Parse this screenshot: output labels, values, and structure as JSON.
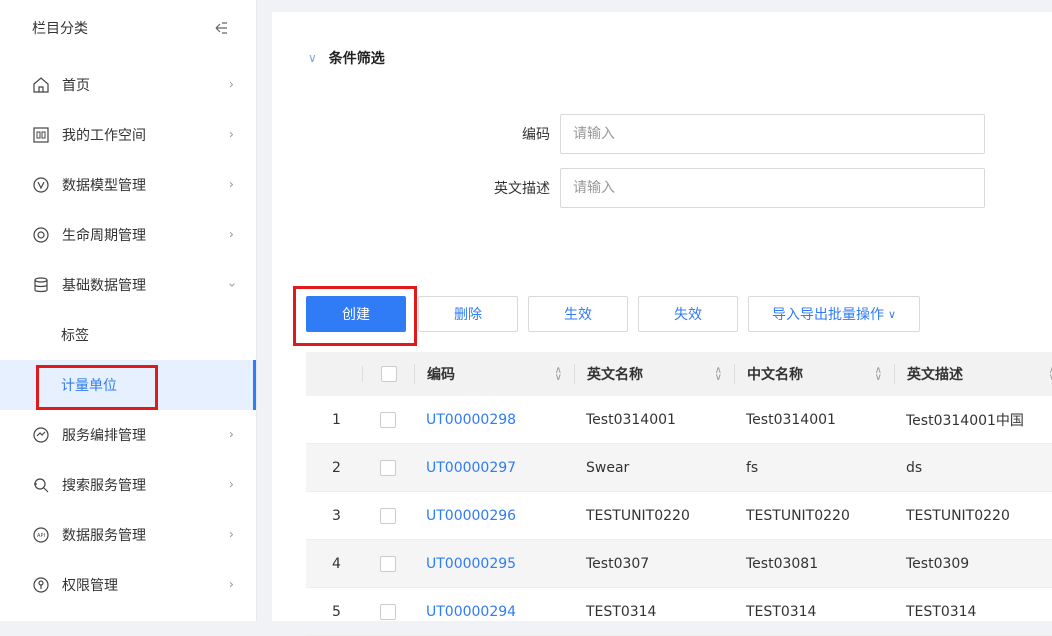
{
  "sidebar": {
    "title": "栏目分类",
    "items": [
      {
        "label": "首页",
        "icon": "home-icon"
      },
      {
        "label": "我的工作空间",
        "icon": "workspace-icon"
      },
      {
        "label": "数据模型管理",
        "icon": "model-icon"
      },
      {
        "label": "生命周期管理",
        "icon": "lifecycle-icon"
      },
      {
        "label": "基础数据管理",
        "icon": "database-icon",
        "expanded": true
      },
      {
        "label": "服务编排管理",
        "icon": "orchestration-icon"
      },
      {
        "label": "搜索服务管理",
        "icon": "search-service-icon"
      },
      {
        "label": "数据服务管理",
        "icon": "api-icon"
      },
      {
        "label": "权限管理",
        "icon": "permission-icon"
      }
    ],
    "sub_items": [
      {
        "label": "标签",
        "active": false
      },
      {
        "label": "计量单位",
        "active": true
      }
    ]
  },
  "filter": {
    "title": "条件筛选",
    "code_label": "编码",
    "code_placeholder": "请输入",
    "desc_label": "英文描述",
    "desc_placeholder": "请输入"
  },
  "toolbar": {
    "create": "创建",
    "delete": "删除",
    "enable": "生效",
    "disable": "失效",
    "batch": "导入导出批量操作"
  },
  "table": {
    "headers": {
      "code": "编码",
      "en": "英文名称",
      "cn": "中文名称",
      "desc": "英文描述"
    },
    "rows": [
      {
        "idx": "1",
        "code": "UT00000298",
        "en": "Test0314001",
        "cn": "Test0314001",
        "desc": "Test0314001中国"
      },
      {
        "idx": "2",
        "code": "UT00000297",
        "en": "Swear",
        "cn": "fs",
        "desc": "ds"
      },
      {
        "idx": "3",
        "code": "UT00000296",
        "en": "TESTUNIT0220",
        "cn": "TESTUNIT0220",
        "desc": "TESTUNIT0220"
      },
      {
        "idx": "4",
        "code": "UT00000295",
        "en": "Test0307",
        "cn": "Test03081",
        "desc": "Test0309"
      },
      {
        "idx": "5",
        "code": "UT00000294",
        "en": "TEST0314",
        "cn": "TEST0314",
        "desc": "TEST0314"
      }
    ]
  },
  "colors": {
    "accent": "#2f7cf6",
    "highlight": "#e0191c"
  }
}
